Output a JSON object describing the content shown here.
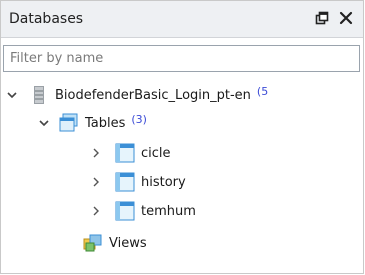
{
  "panel": {
    "title": "Databases",
    "float_icon": "float-window-icon",
    "close_icon": "close-icon"
  },
  "filter": {
    "placeholder": "Filter by name",
    "value": ""
  },
  "tree": {
    "database": {
      "name": "BiodefenderBasic_Login_pt-en",
      "badge": "(5",
      "icon": "database-icon",
      "expanded": true
    },
    "tables_group": {
      "label": "Tables",
      "count": "(3)",
      "icon": "tables-folder-icon",
      "expanded": true
    },
    "tables": [
      {
        "name": "cicle",
        "icon": "table-icon"
      },
      {
        "name": "history",
        "icon": "table-icon"
      },
      {
        "name": "temhum",
        "icon": "table-icon"
      }
    ],
    "views_group": {
      "label": "Views",
      "icon": "views-folder-icon"
    }
  },
  "colors": {
    "accent_blue": "#3b8fd6",
    "count_blue": "#3b4bd6",
    "header_bg": "#eef0f3"
  }
}
